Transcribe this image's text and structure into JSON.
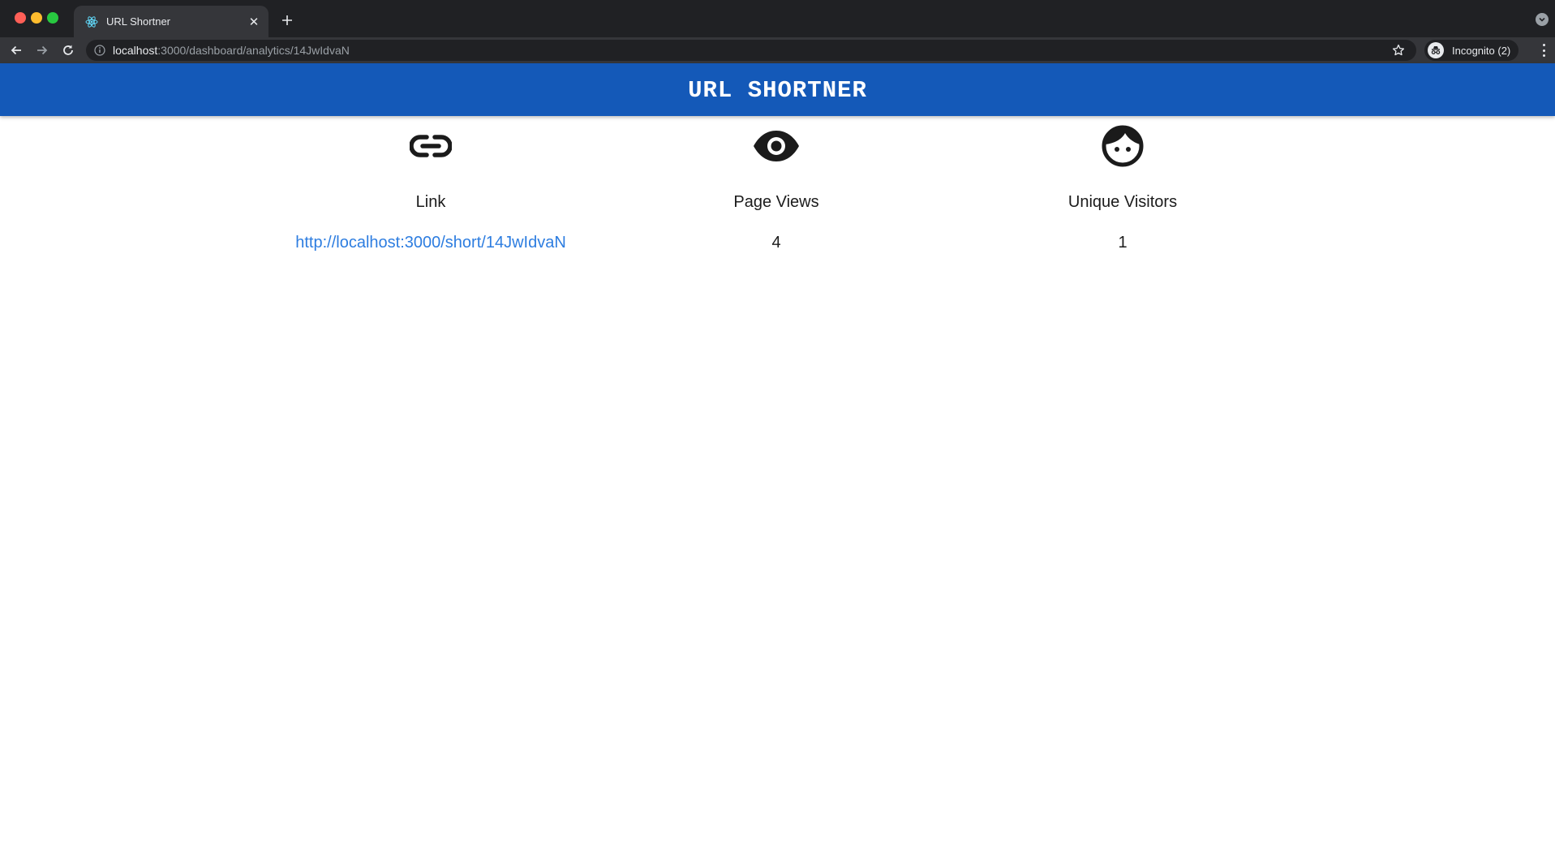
{
  "browser": {
    "tab": {
      "title": "URL Shortner",
      "favicon": "react-icon"
    },
    "address_bar": {
      "host": "localhost",
      "path": ":3000/dashboard/analytics/14JwIdvaN"
    },
    "profile_label": "Incognito (2)"
  },
  "app": {
    "title": "URL SHORTNER",
    "header_color": "#1459b8",
    "stats": [
      {
        "icon": "link-icon",
        "label": "Link",
        "value": "http://localhost:3000/short/14JwIdvaN"
      },
      {
        "icon": "eye-icon",
        "label": "Page Views",
        "value": "4"
      },
      {
        "icon": "face-icon",
        "label": "Unique Visitors",
        "value": "1"
      }
    ]
  }
}
